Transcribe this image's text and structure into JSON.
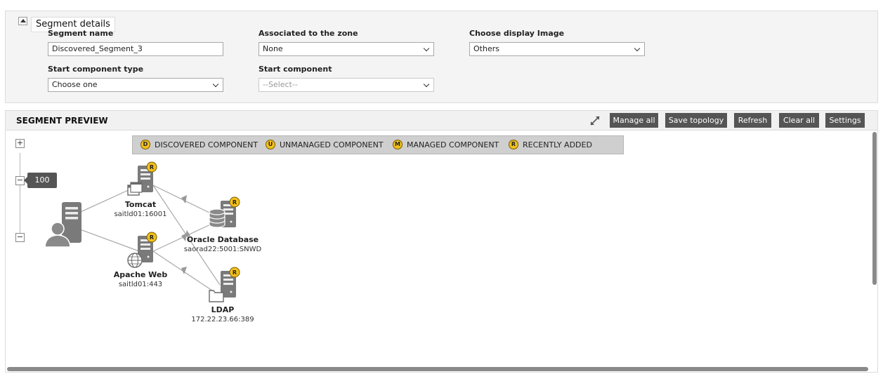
{
  "segment_details": {
    "title": "Segment details",
    "fields": {
      "segment_name": {
        "label": "Segment name",
        "value": "Discovered_Segment_3"
      },
      "zone": {
        "label": "Associated to the zone",
        "value": "None"
      },
      "display_image": {
        "label": "Choose display Image",
        "value": "Others"
      },
      "start_component_type": {
        "label": "Start component type",
        "value": "Choose one"
      },
      "start_component": {
        "label": "Start component",
        "value": "--Select--"
      }
    }
  },
  "preview": {
    "title": "SEGMENT PREVIEW",
    "toolbar": {
      "manage_all": "Manage all",
      "save_topology": "Save topology",
      "refresh": "Refresh",
      "clear_all": "Clear all",
      "settings": "Settings"
    },
    "legend": [
      {
        "badge": "D",
        "label": "DISCOVERED COMPONENT"
      },
      {
        "badge": "U",
        "label": "UNMANAGED COMPONENT"
      },
      {
        "badge": "M",
        "label": "MANAGED COMPONENT"
      },
      {
        "badge": "R",
        "label": "RECENTLY ADDED"
      }
    ],
    "zoom": {
      "value": "100",
      "plus": "+",
      "minus": "−"
    },
    "nodes": {
      "tomcat": {
        "name": "Tomcat",
        "address": "saitld01:16001",
        "badge": "R",
        "icon": "server-window-icon"
      },
      "apache": {
        "name": "Apache Web",
        "address": "saitld01:443",
        "badge": "R",
        "icon": "server-globe-icon"
      },
      "oracle": {
        "name": "Oracle Database",
        "address": "saorad22:5001:SNWD",
        "badge": "R",
        "icon": "server-database-icon"
      },
      "ldap": {
        "name": "LDAP",
        "address": "172.22.23.66:389",
        "badge": "R",
        "icon": "server-folder-icon"
      },
      "user": {
        "icon": "user-server-icon"
      }
    },
    "colors": {
      "button_bg": "#555555",
      "badge": "#f2c01a",
      "legend_bg": "#cfcfcf",
      "icon": "#777777"
    }
  }
}
